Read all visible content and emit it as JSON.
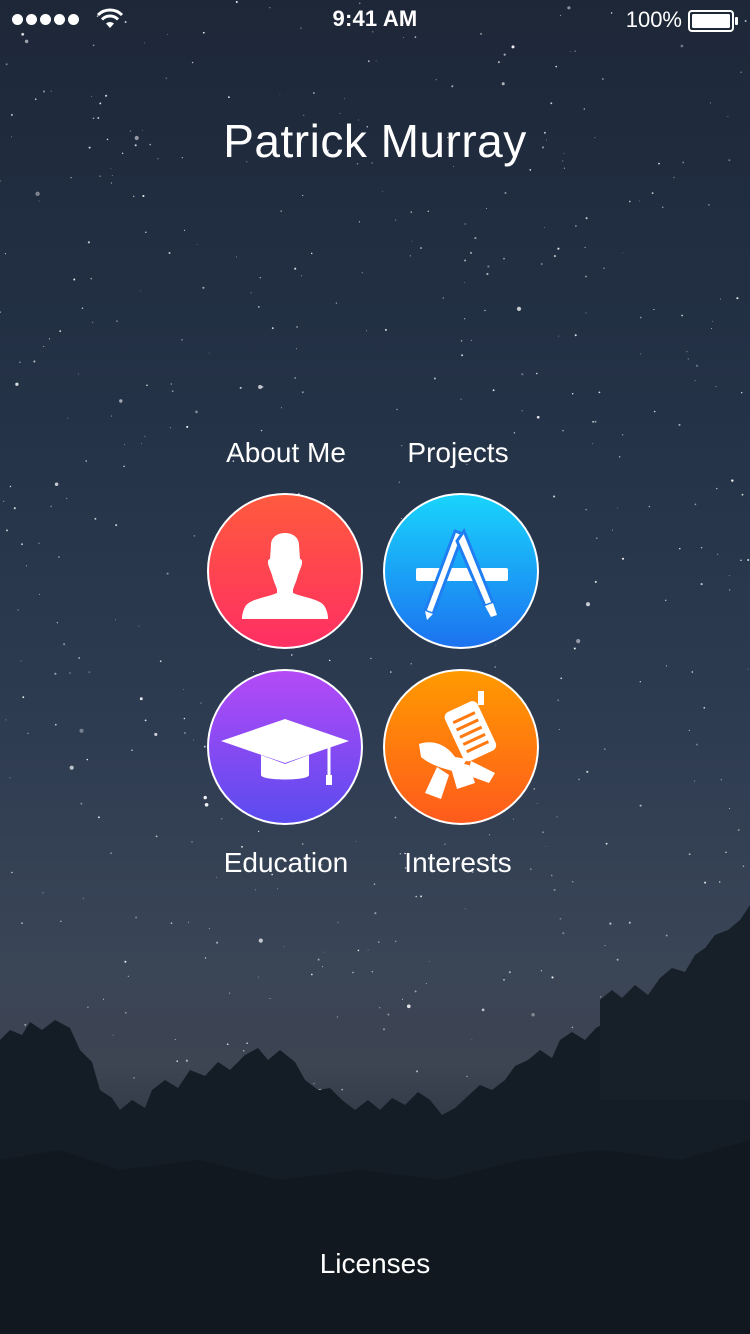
{
  "status_bar": {
    "time": "9:41 AM",
    "battery_percent": "100%",
    "signal_bars": 5,
    "icons": [
      "signal-dots-icon",
      "wifi-icon",
      "battery-icon"
    ]
  },
  "header": {
    "name": "Patrick Murray"
  },
  "menu": {
    "items": [
      {
        "label": "About Me",
        "icon": "person-silhouette-icon",
        "color_top": "#ff5a3e",
        "color_bottom": "#ff2f63"
      },
      {
        "label": "Projects",
        "icon": "app-store-icon",
        "color_top": "#19d4fc",
        "color_bottom": "#1c72f0"
      },
      {
        "label": "Education",
        "icon": "graduation-cap-icon",
        "color_top": "#b44af6",
        "color_bottom": "#5a4bef"
      },
      {
        "label": "Interests",
        "icon": "theater-spotlight-icon",
        "color_top": "#ff9a00",
        "color_bottom": "#ff5b1c"
      }
    ]
  },
  "footer": {
    "licenses_label": "Licenses"
  },
  "colors": {
    "text": "#ffffff",
    "sky_top": "#1d2738",
    "tree_silhouette": "#141c25"
  }
}
